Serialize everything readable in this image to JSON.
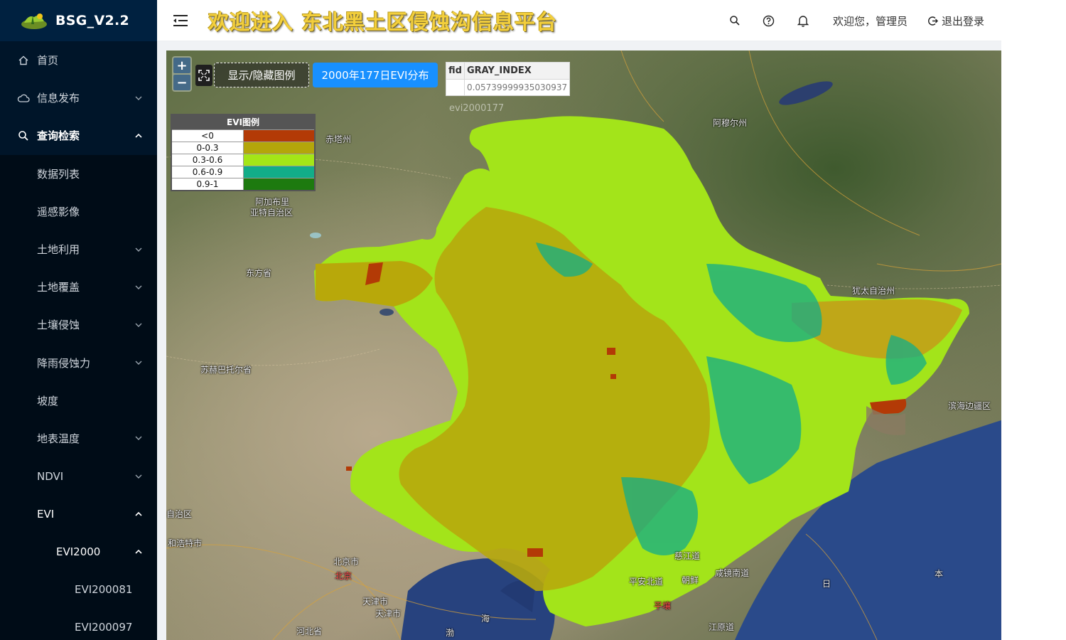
{
  "app": {
    "name": "BSG_V2.2",
    "title": "欢迎进入 东北黑土区侵蚀沟信息平台"
  },
  "header": {
    "welcome": "欢迎您，管理员",
    "logout": "退出登录"
  },
  "sidebar": {
    "items": [
      {
        "label": "首页",
        "icon": "home-icon"
      },
      {
        "label": "信息发布",
        "icon": "cloud-icon",
        "expandable": true
      },
      {
        "label": "查询检索",
        "icon": "search-icon",
        "expanded": true,
        "active": true
      },
      {
        "label": "数据列表"
      },
      {
        "label": "遥感影像"
      },
      {
        "label": "土地利用",
        "expandable": true
      },
      {
        "label": "土地覆盖",
        "expandable": true
      },
      {
        "label": "土壤侵蚀",
        "expandable": true
      },
      {
        "label": "降雨侵蚀力",
        "expandable": true
      },
      {
        "label": "坡度"
      },
      {
        "label": "地表温度",
        "expandable": true
      },
      {
        "label": "NDVI",
        "expandable": true
      },
      {
        "label": "EVI",
        "expanded": true
      },
      {
        "label": "EVI2000",
        "expanded": true
      },
      {
        "label": "EVI200081"
      },
      {
        "label": "EVI200097"
      }
    ]
  },
  "map": {
    "zoom_in": "+",
    "zoom_out": "−",
    "legend_toggle": "显示/隐藏图例",
    "layer_button": "2000年177日EVI分布",
    "feature_layer": "evi2000177",
    "feature_table": {
      "headers": [
        "fid",
        "GRAY_INDEX"
      ],
      "row": [
        "",
        "0.05739999935030937"
      ]
    },
    "legend": {
      "title": "EVI图例",
      "rows": [
        {
          "label": "<0",
          "color": "#b33a06"
        },
        {
          "label": "0-0.3",
          "color": "#b4a60a"
        },
        {
          "label": "0.3-0.6",
          "color": "#a4e617"
        },
        {
          "label": "0.6-0.9",
          "color": "#12ad88"
        },
        {
          "label": "0.9-1",
          "color": "#1d7a0f"
        }
      ]
    },
    "places": {
      "chifeng": "赤塔州",
      "amur": "阿穆尔州",
      "alashan": "阿加布里",
      "alashan2": "亚特自治区",
      "dongfang": "东方省",
      "jewish": "犹太自治州",
      "sukhbaatar": "苏赫巴托尔省",
      "primorsky": "滨海边疆区",
      "zizhiqu": "自治区",
      "hohhot": "和浩特市",
      "beijing_city": "北京市",
      "beijing": "北京",
      "tianjin_city": "天津市",
      "tianjin": "天津市",
      "hebei": "河北省",
      "cijiang": "慈江道",
      "pyongan": "平安北道",
      "korea": "朝鲜",
      "hamgyong": "咸镜南道",
      "pyongyang": "平壤",
      "gangwon": "江原道",
      "bohai1": "海",
      "bohai2": "渤",
      "japan_sea1": "日",
      "japan_sea2": "本"
    }
  }
}
